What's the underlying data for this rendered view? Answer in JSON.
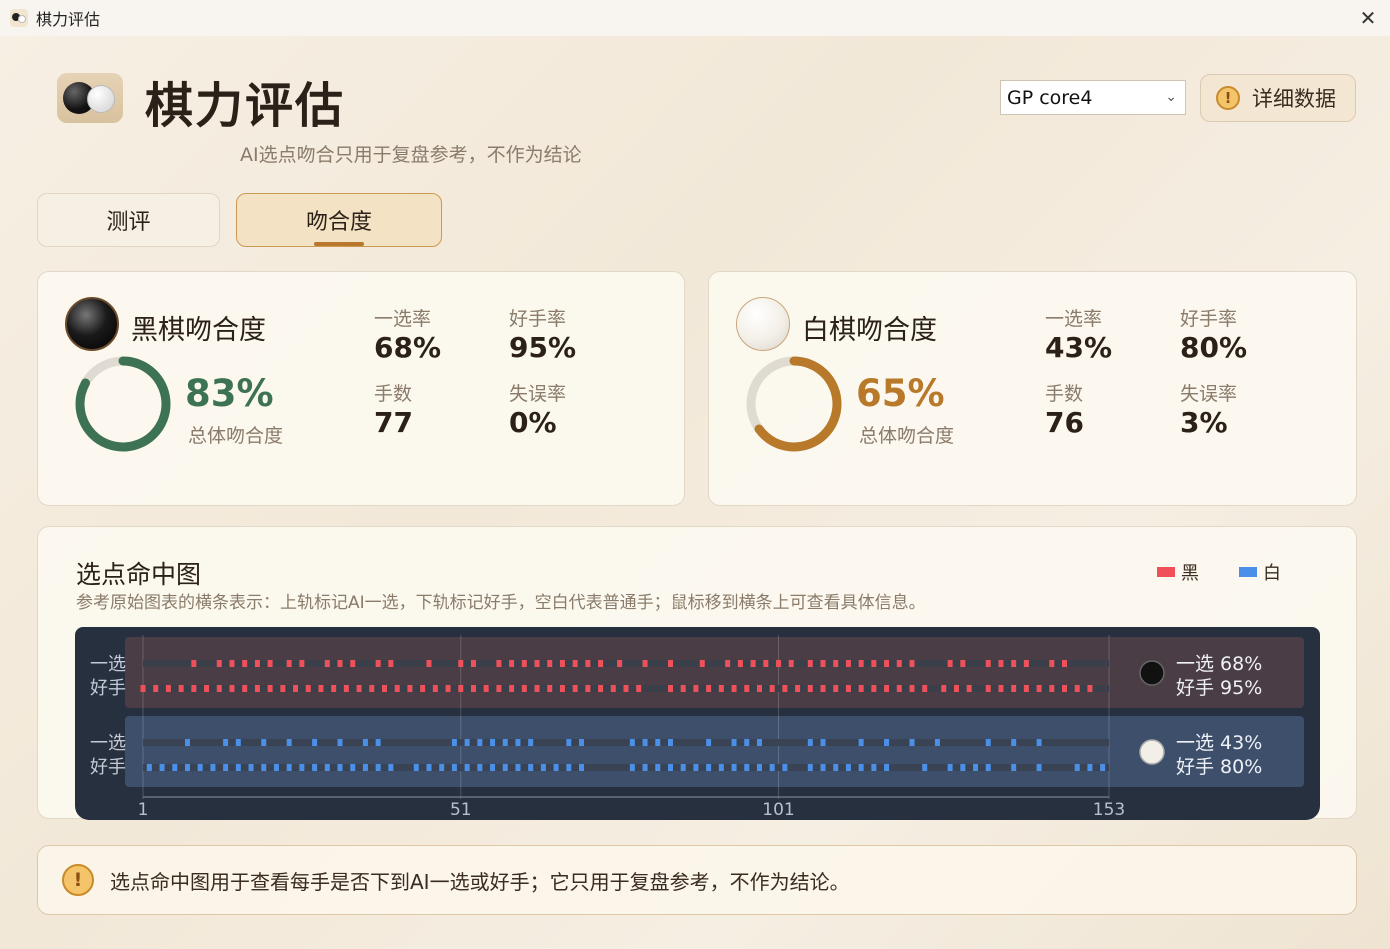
{
  "window": {
    "title": "棋力评估",
    "close_glyph": "✕"
  },
  "header": {
    "title": "棋力评估",
    "subtitle": "AI选点吻合只用于复盘参考，不作为结论",
    "model_select": {
      "value": "GP core4",
      "chevron": "⌄"
    },
    "detail_button": {
      "label": "详细数据",
      "icon": "!"
    }
  },
  "tabs": [
    {
      "label": "测评",
      "active": false
    },
    {
      "label": "吻合度",
      "active": true
    }
  ],
  "black_card": {
    "title": "黑棋吻合度",
    "overall_pct": "83%",
    "overall_value": 0.83,
    "overall_label": "总体吻合度",
    "ring_color": "#3d7254",
    "stats": [
      {
        "label": "一选率",
        "value": "68%"
      },
      {
        "label": "好手率",
        "value": "95%"
      },
      {
        "label": "手数",
        "value": "77"
      },
      {
        "label": "失误率",
        "value": "0%"
      }
    ]
  },
  "white_card": {
    "title": "白棋吻合度",
    "overall_pct": "65%",
    "overall_value": 0.65,
    "overall_label": "总体吻合度",
    "ring_color": "#b8792a",
    "stats": [
      {
        "label": "一选率",
        "value": "43%"
      },
      {
        "label": "好手率",
        "value": "80%"
      },
      {
        "label": "手数",
        "value": "76"
      },
      {
        "label": "失误率",
        "value": "3%"
      }
    ]
  },
  "hit_chart": {
    "title": "选点命中图",
    "description": "参考原始图表的横条表示：上轨标记AI一选，下轨标记好手，空白代表普通手；鼠标移到横条上可查看具体信息。",
    "legend": [
      {
        "label": "黑",
        "color": "#f0505a"
      },
      {
        "label": "白",
        "color": "#4a8fe8"
      }
    ],
    "row_labels": {
      "top": "一选",
      "bottom": "好手"
    },
    "x_ticks": [
      "1",
      "51",
      "101",
      "153"
    ],
    "black_summary": {
      "top": "一选 68%",
      "bottom": "好手 95%"
    },
    "white_summary": {
      "top": "一选 43%",
      "bottom": "好手 80%"
    }
  },
  "chart_data": {
    "type": "table",
    "x_range": [
      1,
      153
    ],
    "series": [
      {
        "name": "黑",
        "color": "#f0505a",
        "first_choice_marks": [
          9,
          13,
          15,
          17,
          19,
          21,
          24,
          26,
          30,
          32,
          34,
          38,
          40,
          46,
          51,
          53,
          57,
          59,
          61,
          63,
          65,
          67,
          69,
          71,
          73,
          76,
          80,
          84,
          89,
          93,
          95,
          97,
          99,
          101,
          103,
          106,
          108,
          110,
          112,
          114,
          116,
          118,
          120,
          122,
          128,
          130,
          134,
          136,
          138,
          140,
          144,
          146
        ],
        "good_move_marks": [
          1,
          3,
          5,
          7,
          9,
          11,
          13,
          15,
          17,
          19,
          21,
          23,
          25,
          27,
          29,
          31,
          33,
          35,
          37,
          39,
          41,
          43,
          45,
          47,
          49,
          51,
          53,
          55,
          57,
          59,
          61,
          63,
          65,
          67,
          69,
          71,
          73,
          75,
          77,
          79,
          84,
          86,
          88,
          90,
          92,
          94,
          96,
          98,
          100,
          102,
          104,
          106,
          108,
          110,
          112,
          114,
          116,
          118,
          120,
          122,
          124,
          127,
          129,
          131,
          134,
          136,
          138,
          140,
          142,
          144,
          146,
          148,
          150
        ]
      },
      {
        "name": "白",
        "color": "#4a8fe8",
        "first_choice_marks": [
          8,
          14,
          16,
          20,
          24,
          28,
          32,
          36,
          38,
          50,
          52,
          54,
          56,
          58,
          60,
          62,
          68,
          70,
          78,
          80,
          82,
          84,
          90,
          94,
          96,
          98,
          106,
          108,
          114,
          118,
          122,
          126,
          134,
          138,
          142
        ],
        "good_move_marks": [
          2,
          4,
          6,
          8,
          10,
          12,
          14,
          16,
          18,
          20,
          22,
          24,
          26,
          28,
          30,
          32,
          34,
          36,
          38,
          40,
          44,
          46,
          48,
          50,
          52,
          54,
          56,
          58,
          60,
          62,
          64,
          66,
          68,
          70,
          78,
          80,
          82,
          84,
          86,
          88,
          90,
          92,
          94,
          96,
          98,
          100,
          102,
          106,
          108,
          110,
          112,
          114,
          116,
          118,
          124,
          128,
          130,
          132,
          134,
          138,
          142,
          148,
          150,
          152
        ]
      }
    ]
  },
  "footer_note": {
    "icon": "!",
    "text": "选点命中图用于查看每手是否下到AI一选或好手；它只用于复盘参考，不作为结论。"
  }
}
